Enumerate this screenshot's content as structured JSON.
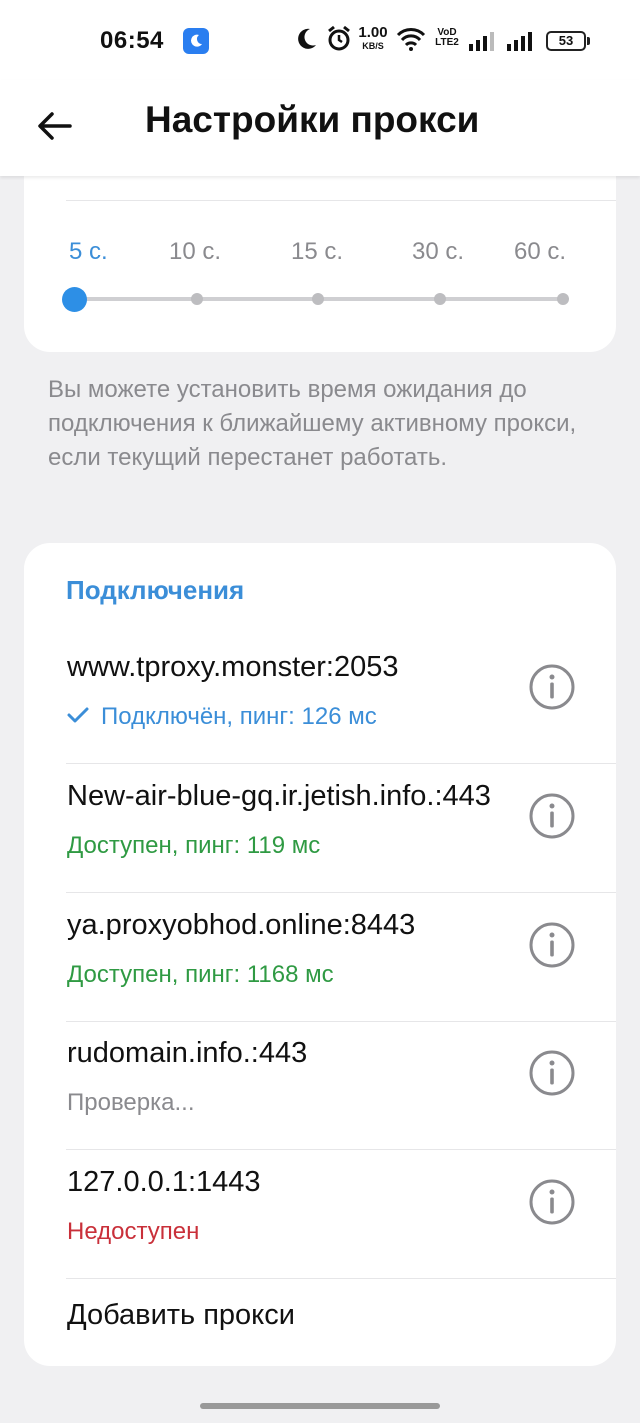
{
  "status_bar": {
    "time": "06:54",
    "net_speed_value": "1.00",
    "net_speed_unit": "KB/S",
    "volte_top": "VoD",
    "volte_bottom": "LTE2",
    "battery": "53"
  },
  "toolbar": {
    "title": "Настройки прокси"
  },
  "timeout_slider": {
    "options": [
      "5 с.",
      "10 с.",
      "15 с.",
      "30 с.",
      "60 с."
    ],
    "selected_index": 0
  },
  "hint_text": "Вы можете установить время ожидания до подключения к ближайшему активному прокси, если текущий перестанет работать.",
  "connections": {
    "header": "Подключения",
    "items": [
      {
        "host": "www.tproxy.monster:2053",
        "status": "Подключён, пинг: 126 мс",
        "state": "connected"
      },
      {
        "host": "New-air-blue-gq.ir.jetish.info.:443",
        "status": "Доступен, пинг: 119 мс",
        "state": "available"
      },
      {
        "host": "ya.proxyobhod.online:8443",
        "status": "Доступен, пинг: 1168 мс",
        "state": "available"
      },
      {
        "host": "rudomain.info.:443",
        "status": "Проверка...",
        "state": "checking"
      },
      {
        "host": "127.0.0.1:1443",
        "status": "Недоступен",
        "state": "unavailable"
      }
    ],
    "add_label": "Добавить прокси"
  },
  "colors": {
    "accent": "#3b8ed8",
    "available": "#2f9a43",
    "unavailable": "#c9303a",
    "muted": "#8a8a8e"
  }
}
